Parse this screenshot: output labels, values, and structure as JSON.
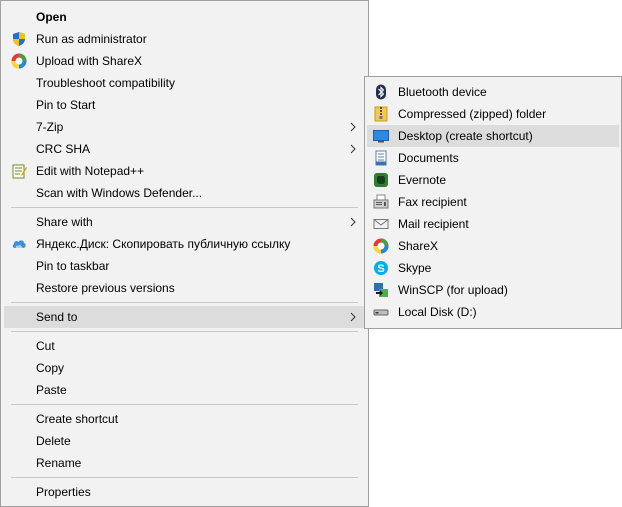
{
  "main_menu": {
    "items": [
      {
        "label": "Open"
      },
      {
        "label": "Run as administrator",
        "icon": "uac-shield-icon"
      },
      {
        "label": "Upload with ShareX",
        "icon": "sharex-icon"
      },
      {
        "label": "Troubleshoot compatibility"
      },
      {
        "label": "Pin to Start"
      },
      {
        "label": "7-Zip"
      },
      {
        "label": "CRC SHA"
      },
      {
        "label": "Edit with Notepad++",
        "icon": "notepadpp-icon"
      },
      {
        "label": "Scan with Windows Defender..."
      },
      {
        "label": "Share with"
      },
      {
        "label": "Яндекс.Диск: Скопировать публичную ссылку",
        "icon": "yandex-disk-icon"
      },
      {
        "label": "Pin to taskbar"
      },
      {
        "label": "Restore previous versions"
      },
      {
        "label": "Send to"
      },
      {
        "label": "Cut"
      },
      {
        "label": "Copy"
      },
      {
        "label": "Paste"
      },
      {
        "label": "Create shortcut"
      },
      {
        "label": "Delete"
      },
      {
        "label": "Rename"
      },
      {
        "label": "Properties"
      }
    ]
  },
  "send_to_menu": {
    "items": [
      {
        "label": "Bluetooth device",
        "icon": "bluetooth-icon"
      },
      {
        "label": "Compressed (zipped) folder",
        "icon": "zip-folder-icon"
      },
      {
        "label": "Desktop (create shortcut)",
        "icon": "desktop-icon"
      },
      {
        "label": "Documents",
        "icon": "documents-icon"
      },
      {
        "label": "Evernote",
        "icon": "evernote-icon"
      },
      {
        "label": "Fax recipient",
        "icon": "fax-icon"
      },
      {
        "label": "Mail recipient",
        "icon": "mail-icon"
      },
      {
        "label": "ShareX",
        "icon": "sharex-icon"
      },
      {
        "label": "Skype",
        "icon": "skype-icon"
      },
      {
        "label": "WinSCP (for upload)",
        "icon": "winscp-icon"
      },
      {
        "label": "Local Disk (D:)",
        "icon": "drive-icon"
      }
    ]
  },
  "colors": {
    "menu_bg": "#f2f2f2",
    "highlight": "#dcdcdc",
    "border": "#a0a0a0",
    "separator": "#c8c8c8"
  }
}
